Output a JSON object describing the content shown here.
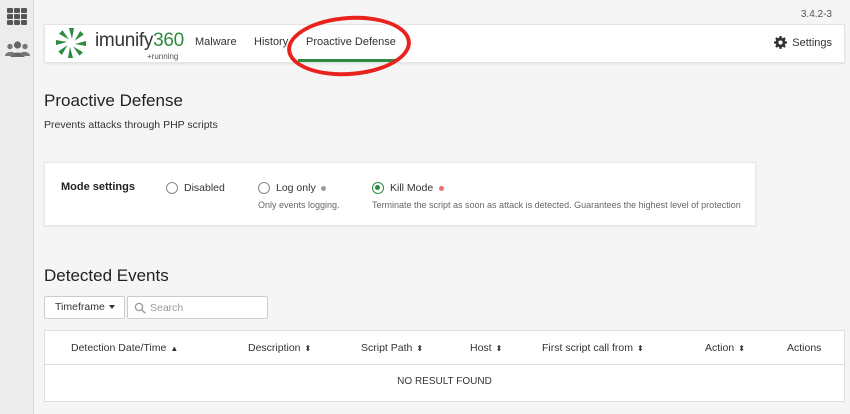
{
  "app": {
    "version": "3.4.2-3",
    "brand_prefix": "imunify",
    "brand_suffix": "360",
    "status": "+running",
    "accent_color": "#2e8b3d",
    "highlight_color": "#e8231d"
  },
  "nav": {
    "items": [
      {
        "label": "Malware"
      },
      {
        "label": "History"
      },
      {
        "label": "Proactive Defense",
        "active": true
      }
    ],
    "settings_label": "Settings"
  },
  "page": {
    "title": "Proactive Defense",
    "subtitle": "Prevents attacks through PHP scripts"
  },
  "mode": {
    "label": "Mode settings",
    "options": [
      {
        "label": "Disabled",
        "description": "",
        "selected": false
      },
      {
        "label": "Log only",
        "description": "Only events logging.",
        "selected": false,
        "dot_color": "#9a9a9a"
      },
      {
        "label": "Kill Mode",
        "description": "Terminate the script as soon as attack is detected. Guarantees the highest level of protection",
        "selected": true,
        "dot_color": "#e57373"
      }
    ]
  },
  "events": {
    "title": "Detected Events",
    "timeframe_label": "Timeframe",
    "search_placeholder": "Search",
    "columns": [
      {
        "label": "Detection Date/Time",
        "sort": "▲"
      },
      {
        "label": "Description",
        "sort": "⬍"
      },
      {
        "label": "Script Path",
        "sort": "⬍"
      },
      {
        "label": "Host",
        "sort": "⬍"
      },
      {
        "label": "First script call from",
        "sort": "⬍"
      },
      {
        "label": "Action",
        "sort": "⬍"
      },
      {
        "label": "Actions",
        "sort": ""
      }
    ],
    "empty_text": "NO RESULT FOUND"
  }
}
